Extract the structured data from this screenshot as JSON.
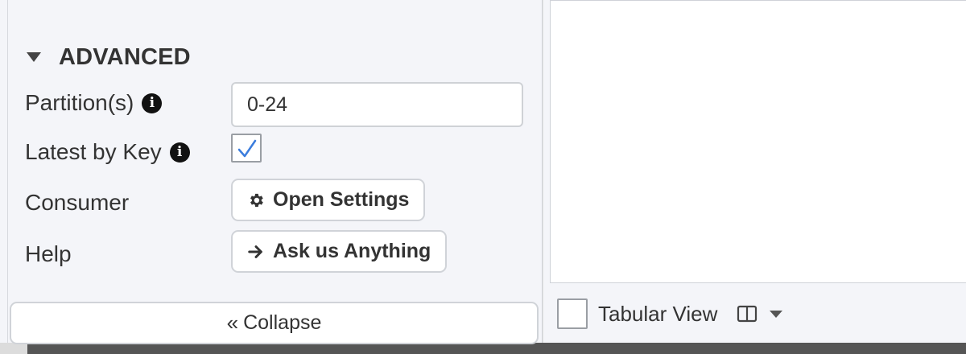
{
  "advanced": {
    "title": "ADVANCED",
    "partitions": {
      "label": "Partition(s)",
      "value": "0-24"
    },
    "latest_by_key": {
      "label": "Latest by Key",
      "checked": true
    },
    "consumer": {
      "label": "Consumer",
      "button_label": "Open Settings",
      "icon": "gear-icon"
    },
    "help": {
      "label": "Help",
      "button_label": "Ask us Anything",
      "icon": "arrow-right-icon"
    }
  },
  "collapse": {
    "label": "Collapse",
    "icon": "double-chevron-left-icon"
  },
  "view": {
    "tabular_label": "Tabular View",
    "tabular_checked": false,
    "columns_icon": "columns-icon"
  },
  "colors": {
    "panel_bg": "#f4f5f9",
    "text": "#333333",
    "check": "#3b7ddd"
  }
}
